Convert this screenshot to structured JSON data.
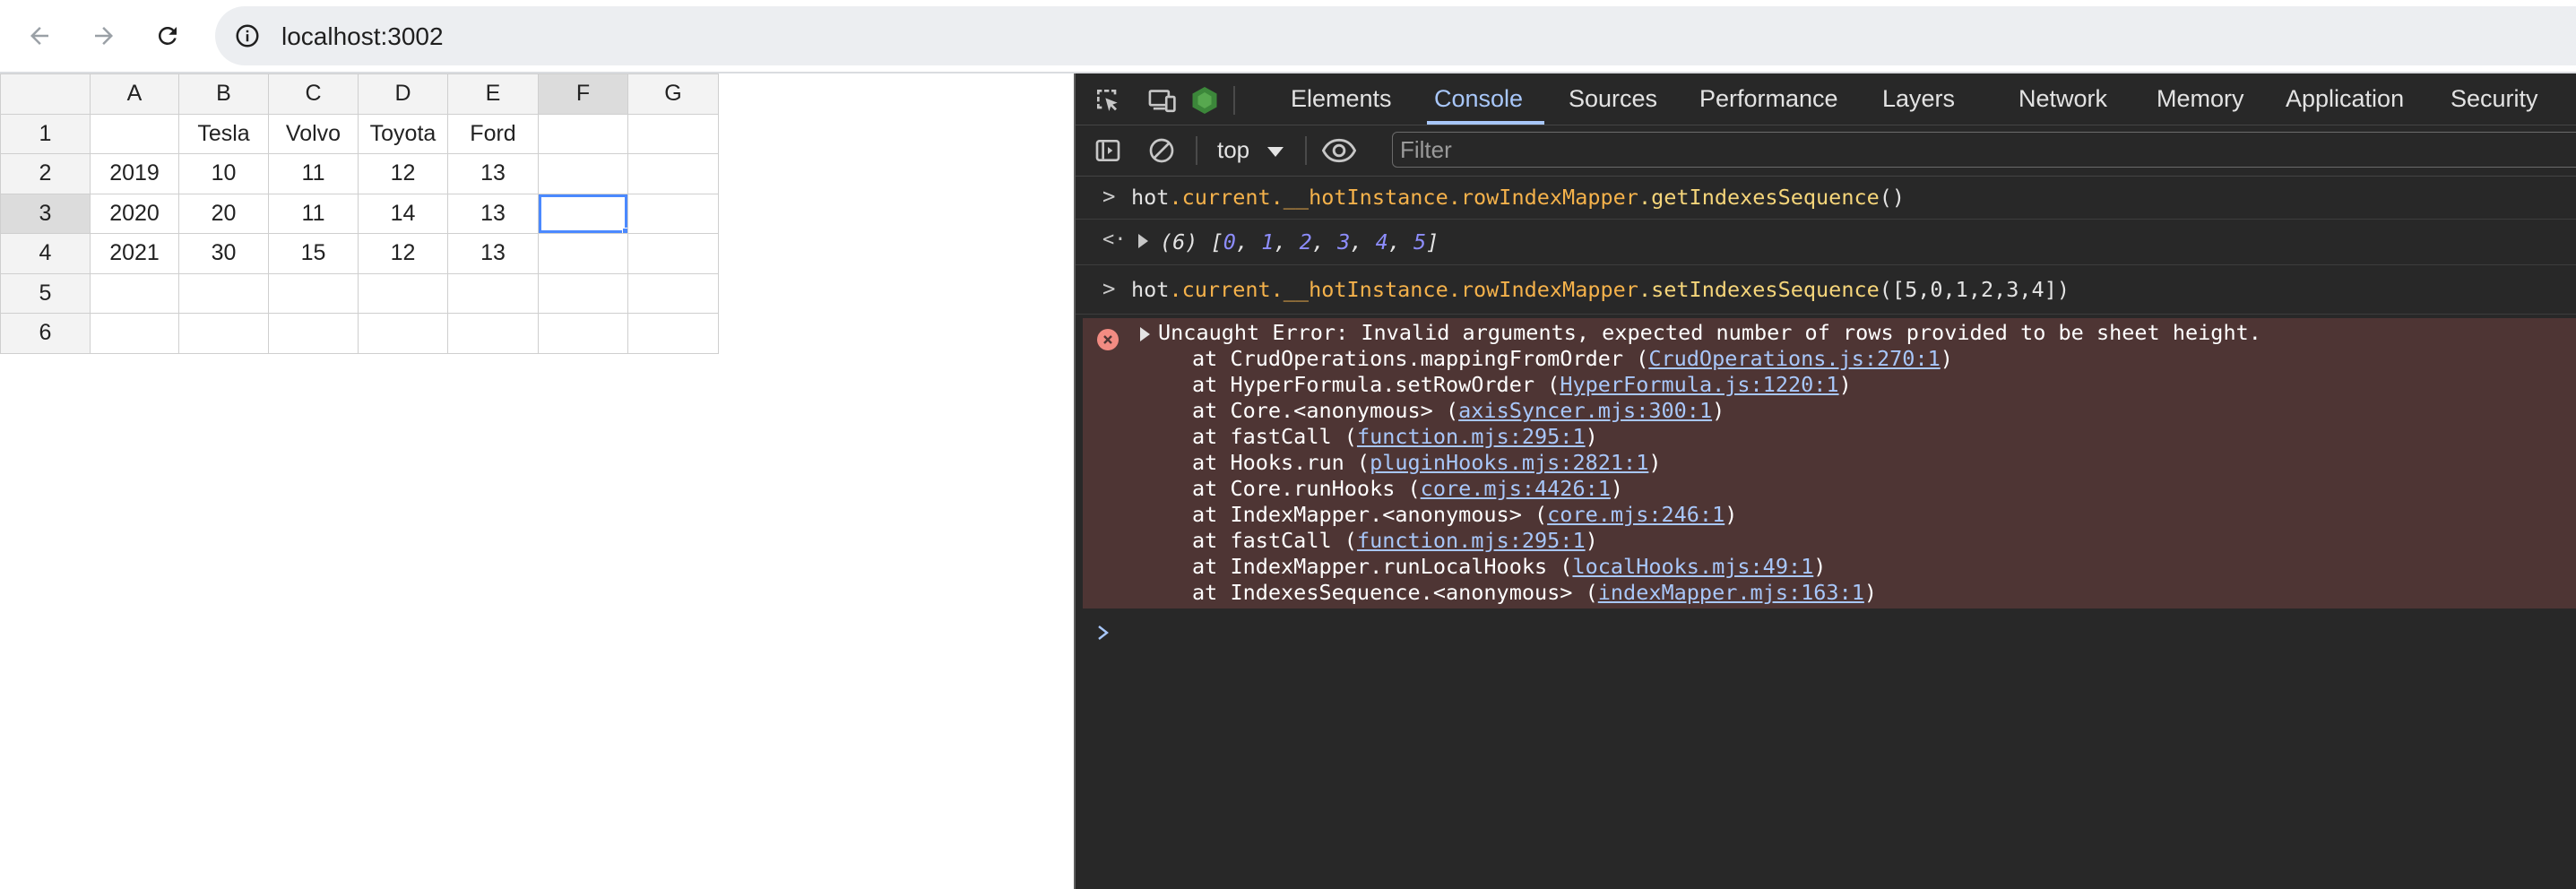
{
  "browser": {
    "url": "localhost:3002",
    "back_icon": "arrow-back-icon",
    "forward_icon": "arrow-forward-icon",
    "reload_icon": "reload-icon",
    "info_icon": "site-info-icon"
  },
  "sheet": {
    "col_headers": [
      "A",
      "B",
      "C",
      "D",
      "E",
      "F",
      "G"
    ],
    "row_headers": [
      "1",
      "2",
      "3",
      "4",
      "5",
      "6"
    ],
    "active_col": "F",
    "active_row": "3",
    "rows": [
      [
        "",
        "Tesla",
        "Volvo",
        "Toyota",
        "Ford",
        "",
        ""
      ],
      [
        "2019",
        "10",
        "11",
        "12",
        "13",
        "",
        ""
      ],
      [
        "2020",
        "20",
        "11",
        "14",
        "13",
        "",
        ""
      ],
      [
        "2021",
        "30",
        "15",
        "12",
        "13",
        "",
        ""
      ],
      [
        "",
        "",
        "",
        "",
        "",
        "",
        ""
      ],
      [
        "",
        "",
        "",
        "",
        "",
        "",
        ""
      ]
    ],
    "selection_color": "#4b89ff"
  },
  "devtools": {
    "tabs": [
      "Elements",
      "Console",
      "Sources",
      "Performance",
      "Layers",
      "Network",
      "Memory",
      "Application",
      "Security"
    ],
    "active_tab": "Console",
    "context": "top",
    "filter_placeholder": "Filter",
    "console": {
      "cmd1": {
        "obj": "hot",
        "p1": ".current",
        "p2": ".__hotInstance",
        "p3": ".rowIndexMapper",
        "method": ".getIndexesSequence",
        "args": "()"
      },
      "result1": {
        "count": "(6)",
        "open": "[",
        "values": [
          "0",
          "1",
          "2",
          "3",
          "4",
          "5"
        ],
        "close": "]"
      },
      "cmd2": {
        "obj": "hot",
        "p1": ".current",
        "p2": ".__hotInstance",
        "p3": ".rowIndexMapper",
        "method": ".setIndexesSequence",
        "args": "([5,0,1,2,3,4])"
      },
      "error": {
        "message": "Uncaught Error: Invalid arguments, expected number of rows provided to be sheet height.",
        "stack": [
          {
            "fn": "at CrudOperations.mappingFromOrder (",
            "link": "CrudOperations.js:270:1",
            "end": ")"
          },
          {
            "fn": "at HyperFormula.setRowOrder (",
            "link": "HyperFormula.js:1220:1",
            "end": ")"
          },
          {
            "fn": "at Core.<anonymous> (",
            "link": "axisSyncer.mjs:300:1",
            "end": ")"
          },
          {
            "fn": "at fastCall (",
            "link": "function.mjs:295:1",
            "end": ")"
          },
          {
            "fn": "at Hooks.run (",
            "link": "pluginHooks.mjs:2821:1",
            "end": ")"
          },
          {
            "fn": "at Core.runHooks (",
            "link": "core.mjs:4426:1",
            "end": ")"
          },
          {
            "fn": "at IndexMapper.<anonymous> (",
            "link": "core.mjs:246:1",
            "end": ")"
          },
          {
            "fn": "at fastCall (",
            "link": "function.mjs:295:1",
            "end": ")"
          },
          {
            "fn": "at IndexMapper.runLocalHooks (",
            "link": "localHooks.mjs:49:1",
            "end": ")"
          },
          {
            "fn": "at IndexesSequence.<anonymous> (",
            "link": "indexMapper.mjs:163:1",
            "end": ")"
          }
        ]
      },
      "prompt_char": ">",
      "result_char": "<·"
    },
    "colors": {
      "background": "#282828",
      "active_tab": "#a8c7fa",
      "error_bg": "#4e3534",
      "link": "#a8c7fa"
    }
  }
}
